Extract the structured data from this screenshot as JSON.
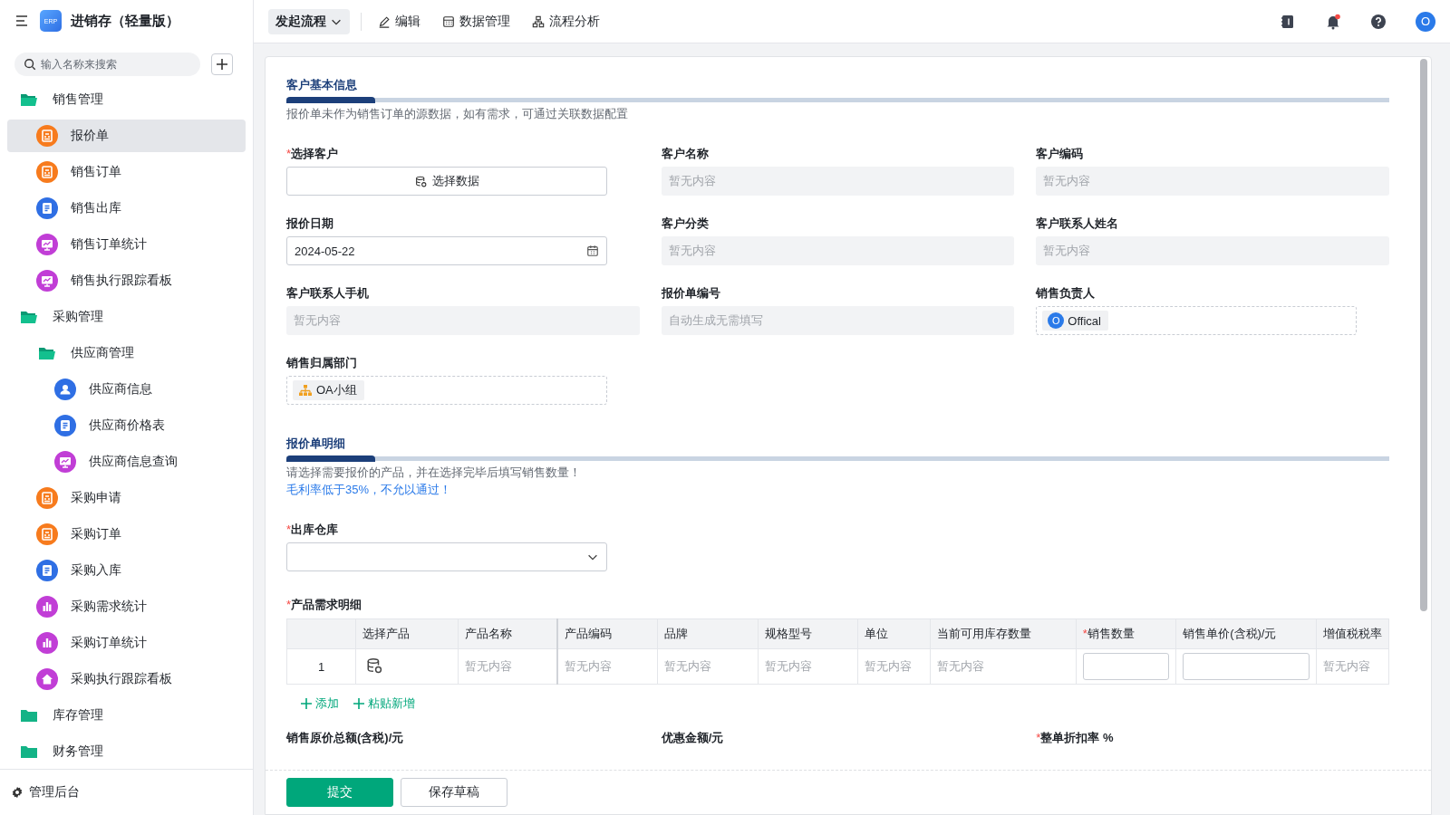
{
  "app": {
    "title": "进销存（轻量版）",
    "logo": "ERP"
  },
  "required_marker": "*",
  "sidebar": {
    "search": {
      "placeholder": "输入名称来搜索"
    },
    "items": [
      {
        "kind": "folder",
        "label": "销售管理",
        "expanded": true,
        "children": [
          {
            "kind": "form",
            "label": "报价单",
            "selected": true
          },
          {
            "kind": "form",
            "label": "销售订单",
            "selected": false
          },
          {
            "kind": "doc",
            "label": "销售出库",
            "selected": false
          },
          {
            "kind": "dashboard",
            "label": "销售订单统计",
            "selected": false
          },
          {
            "kind": "dashboard",
            "label": "销售执行跟踪看板",
            "selected": false
          }
        ]
      },
      {
        "kind": "folder",
        "label": "采购管理",
        "expanded": true,
        "children": [
          {
            "kind": "folder",
            "label": "供应商管理",
            "expanded": true,
            "children": [
              {
                "kind": "contact",
                "label": "供应商信息",
                "selected": false
              },
              {
                "kind": "doc",
                "label": "供应商价格表",
                "selected": false
              },
              {
                "kind": "dashboard",
                "label": "供应商信息查询",
                "selected": false
              }
            ]
          },
          {
            "kind": "form",
            "label": "采购申请",
            "selected": false
          },
          {
            "kind": "form",
            "label": "采购订单",
            "selected": false
          },
          {
            "kind": "doc",
            "label": "采购入库",
            "selected": false
          },
          {
            "kind": "stats",
            "label": "采购需求统计",
            "selected": false
          },
          {
            "kind": "stats",
            "label": "采购订单统计",
            "selected": false
          },
          {
            "kind": "home",
            "label": "采购执行跟踪看板",
            "selected": false
          }
        ]
      },
      {
        "kind": "folder",
        "label": "库存管理",
        "expanded": false
      },
      {
        "kind": "folder",
        "label": "财务管理",
        "expanded": false
      }
    ],
    "footer": "管理后台"
  },
  "toolbar": {
    "start_button": "发起流程",
    "actions": [
      {
        "kind": "edit",
        "label": "编辑"
      },
      {
        "kind": "data",
        "label": "数据管理"
      },
      {
        "kind": "flow",
        "label": "流程分析"
      }
    ],
    "notifications_unread": true,
    "avatar": "O"
  },
  "sections": [
    {
      "title": "客户基本信息",
      "notes": [
        {
          "kind": "info",
          "text": "报价单未作为销售订单的源数据，如有需求，可通过关联数据配置"
        }
      ],
      "fields": [
        {
          "label": "选择客户",
          "required": true,
          "kind": "picker",
          "value": "选择数据"
        },
        {
          "label": "客户名称",
          "required": false,
          "kind": "readonly",
          "placeholder": "暂无内容"
        },
        {
          "label": "客户编码",
          "required": false,
          "kind": "readonly",
          "placeholder": "暂无内容"
        },
        {
          "label": "报价日期",
          "required": false,
          "kind": "date",
          "value": "2024-05-22"
        },
        {
          "label": "客户分类",
          "required": false,
          "kind": "readonly",
          "placeholder": "暂无内容"
        },
        {
          "label": "客户联系人姓名",
          "required": false,
          "kind": "readonly",
          "placeholder": "暂无内容"
        },
        {
          "label": "客户联系人手机",
          "required": false,
          "kind": "readonly",
          "placeholder": "暂无内容"
        },
        {
          "label": "报价单编号",
          "required": false,
          "kind": "readonly",
          "placeholder": "自动生成无需填写"
        },
        {
          "label": "销售负责人",
          "required": false,
          "kind": "user",
          "value": "Offical",
          "avatar": "O"
        },
        {
          "label": "销售归属部门",
          "required": false,
          "kind": "dept",
          "value": "OA小组"
        }
      ]
    },
    {
      "title": "报价单明细",
      "notes": [
        {
          "kind": "info",
          "text": "请选择需要报价的产品，并在选择完毕后填写销售数量！"
        },
        {
          "kind": "warning",
          "text": "毛利率低于35%，不允以通过！"
        }
      ],
      "fields": [
        {
          "label": "出库仓库",
          "required": true,
          "kind": "select"
        }
      ]
    }
  ],
  "product_table": {
    "label": "产品需求明细",
    "required": true,
    "columns": [
      {
        "label": "选择产品",
        "required": false
      },
      {
        "label": "产品名称",
        "required": false
      },
      {
        "label": "产品编码",
        "required": false
      },
      {
        "label": "品牌",
        "required": false
      },
      {
        "label": "规格型号",
        "required": false
      },
      {
        "label": "单位",
        "required": false
      },
      {
        "label": "当前可用库存数量",
        "required": false
      },
      {
        "label": "销售数量",
        "required": true
      },
      {
        "label": "销售单价(含税)/元",
        "required": false
      },
      {
        "label": "增值税税率",
        "required": false
      }
    ],
    "rows": [
      {
        "index": "1",
        "cells": [
          {
            "kind": "picker"
          },
          {
            "kind": "readonly",
            "text": "暂无内容"
          },
          {
            "kind": "readonly",
            "text": "暂无内容"
          },
          {
            "kind": "readonly",
            "text": "暂无内容"
          },
          {
            "kind": "readonly",
            "text": "暂无内容"
          },
          {
            "kind": "readonly",
            "text": "暂无内容"
          },
          {
            "kind": "readonly",
            "text": "暂无内容"
          },
          {
            "kind": "input"
          },
          {
            "kind": "input"
          },
          {
            "kind": "readonly",
            "text": "暂无内容"
          }
        ]
      }
    ],
    "actions": [
      "添加",
      "粘贴新增"
    ]
  },
  "summary_fields": [
    {
      "label": "销售原价总额(含税)/元",
      "required": false
    },
    {
      "label": "优惠金额/元",
      "required": false
    },
    {
      "label": "整单折扣率 %",
      "required": true
    }
  ],
  "footer_buttons": [
    {
      "kind": "primary",
      "label": "提交"
    },
    {
      "kind": "default",
      "label": "保存草稿"
    }
  ]
}
